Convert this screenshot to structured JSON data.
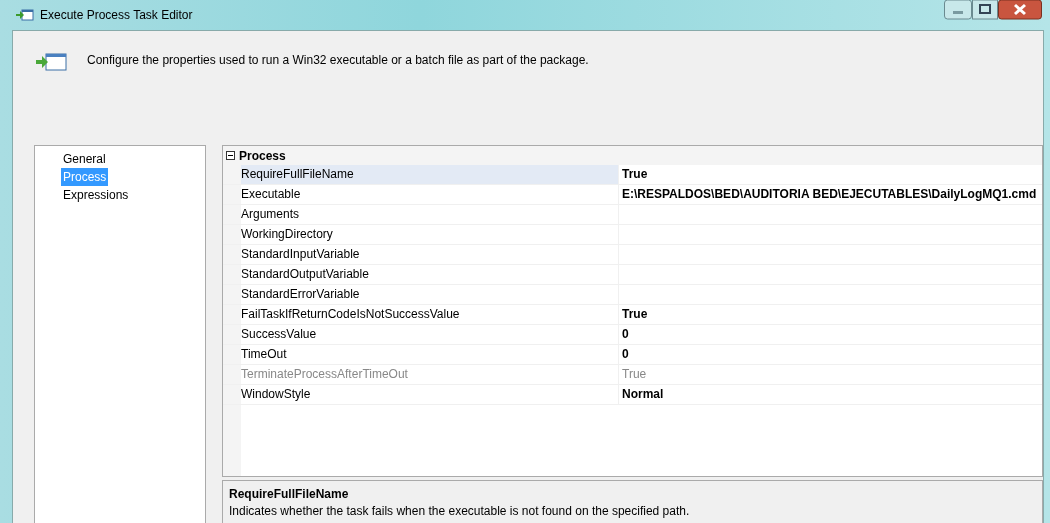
{
  "window": {
    "title": "Execute Process Task Editor"
  },
  "header": {
    "description": "Configure the properties used to run a Win32 executable or a batch file as part of the package."
  },
  "pages": [
    {
      "label": "General",
      "selected": false
    },
    {
      "label": "Process",
      "selected": true
    },
    {
      "label": "Expressions",
      "selected": false
    }
  ],
  "property_grid": {
    "category": {
      "label": "Process",
      "expanded": true
    },
    "properties": [
      {
        "name": "RequireFullFileName",
        "value": "True",
        "modified": true,
        "disabled": false,
        "selected": true
      },
      {
        "name": "Executable",
        "value": "E:\\RESPALDOS\\BED\\AUDITORIA BED\\EJECUTABLES\\DailyLogMQ1.cmd",
        "modified": true,
        "disabled": false,
        "selected": false
      },
      {
        "name": "Arguments",
        "disabled": false,
        "selected": false
      },
      {
        "name": "WorkingDirectory",
        "disabled": false,
        "selected": false
      },
      {
        "name": "StandardInputVariable",
        "disabled": false,
        "selected": false
      },
      {
        "name": "StandardOutputVariable",
        "disabled": false,
        "selected": false
      },
      {
        "name": "StandardErrorVariable",
        "disabled": false,
        "selected": false
      },
      {
        "name": "FailTaskIfReturnCodeIsNotSuccessValue",
        "value": "True",
        "modified": true,
        "disabled": false,
        "selected": false
      },
      {
        "name": "SuccessValue",
        "value": "0",
        "modified": true,
        "disabled": false,
        "selected": false
      },
      {
        "name": "TimeOut",
        "value": "0",
        "modified": true,
        "disabled": false,
        "selected": false
      },
      {
        "name": "TerminateProcessAfterTimeOut",
        "value": "True",
        "modified": false,
        "disabled": true,
        "selected": false
      },
      {
        "name": "WindowStyle",
        "value": "Normal",
        "modified": true,
        "disabled": false,
        "selected": false
      }
    ]
  },
  "description_panel": {
    "title": "RequireFullFileName",
    "text": "Indicates whether the task fails when the executable is not found on the specified path."
  }
}
